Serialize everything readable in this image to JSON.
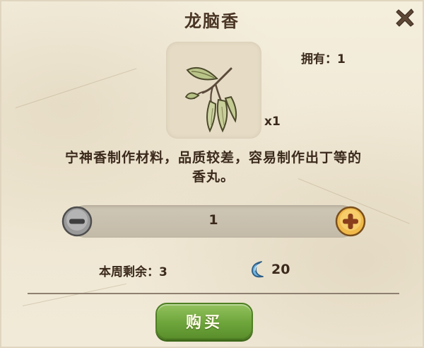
{
  "dialog": {
    "title": "龙脑香",
    "close_icon": "close-x-icon",
    "accent_colors": {
      "title_text": "#4a3524",
      "buy_button": "#6ea53b",
      "plus_button": "#f0b94a",
      "minus_button": "#8a8a8a",
      "currency": "#6fb3e0"
    }
  },
  "item": {
    "name": "龙脑香",
    "icon": "longnaoxiang-herb-icon",
    "owned_label": "拥有：1",
    "quantity_tag": "x1",
    "description_line1": "宁神香制作材料，品质较差，容易制作出丁等的",
    "description_line2": "香丸。"
  },
  "purchase": {
    "quantity": "1",
    "minus_icon": "minus-circle-icon",
    "plus_icon": "plus-circle-icon",
    "weekly_remaining_label": "本周剩余：3",
    "currency_icon": "crescent-moon-icon",
    "price": "20",
    "buy_label": "购买"
  }
}
